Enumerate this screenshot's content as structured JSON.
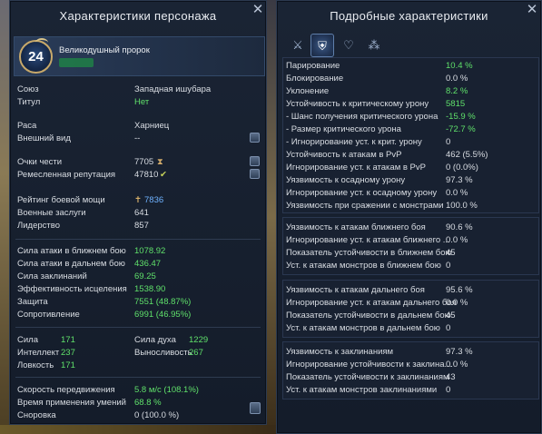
{
  "left": {
    "title": "Характеристики персонажа",
    "close": "✕",
    "character": {
      "level": "24",
      "title": "Великодушный пророк",
      "name_color": "#1f8a46"
    },
    "info": [
      {
        "label": "Союз",
        "value": "Западная ишубара"
      },
      {
        "label": "Титул",
        "value": "Нет"
      },
      {
        "label": "Раса",
        "value": "Харниец"
      },
      {
        "label": "Внешний вид",
        "value": "--"
      },
      {
        "label": "Очки чести",
        "value": "7705"
      },
      {
        "label": "Ремесленная репутация",
        "value": "47810"
      },
      {
        "label": "Рейтинг боевой мощи",
        "value": "7836"
      },
      {
        "label": "Военные заслуги",
        "value": "641"
      },
      {
        "label": "Лидерство",
        "value": "857"
      }
    ],
    "combat": [
      {
        "label": "Сила атаки в ближнем бою",
        "value": "1078.92"
      },
      {
        "label": "Сила атаки в дальнем бою",
        "value": "436.47"
      },
      {
        "label": "Сила заклинаний",
        "value": "69.25"
      },
      {
        "label": "Эффективность исцеления",
        "value": "1538.90"
      },
      {
        "label": "Защита",
        "value": "7551 (48.87%)"
      },
      {
        "label": "Сопротивление",
        "value": "6991 (46.95%)"
      }
    ],
    "attributes": [
      {
        "label": "Сила",
        "value": "171"
      },
      {
        "label": "Сила духа",
        "value": "1229"
      },
      {
        "label": "Интеллект",
        "value": "237"
      },
      {
        "label": "Выносливость",
        "value": "267"
      },
      {
        "label": "Ловкость",
        "value": "171"
      }
    ],
    "speed": [
      {
        "label": "Скорость передвижения",
        "value": "5.8 м/с (108.1%)"
      },
      {
        "label": "Время применения умений",
        "value": "68.8 %"
      },
      {
        "label": "Сноровка",
        "value": "0 (100.0 %)"
      }
    ]
  },
  "right": {
    "title": "Подробные характеристики",
    "close": "✕",
    "tabs": [
      "⚔",
      "⛨",
      "♡",
      "⁂"
    ],
    "section1": [
      {
        "label": "Парирование",
        "value": "10.4 %"
      },
      {
        "label": "Блокирование",
        "value": "0.0 %"
      },
      {
        "label": "Уклонение",
        "value": "8.2 %"
      },
      {
        "label": "Устойчивость к критическому урону",
        "value": "5815"
      },
      {
        "label": "- Шанс получения критического урона",
        "value": "-15.9 %"
      },
      {
        "label": "- Размер критического урона",
        "value": "-72.7 %"
      },
      {
        "label": "- Игнорирование уст. к крит. урону",
        "value": "0"
      },
      {
        "label": "Устойчивость к атакам в PvP",
        "value": "462 (5.5%)"
      },
      {
        "label": "Игнорирование уст. к атакам в PvP",
        "value": "0 (0.0%)"
      },
      {
        "label": "Уязвимость к осадному урону",
        "value": "97.3 %"
      },
      {
        "label": "Игнорирование уст. к осадному урону",
        "value": "0.0 %"
      },
      {
        "label": "Уязвимость при сражении с монстрами",
        "value": "100.0 %"
      }
    ],
    "section2": [
      {
        "label": "Уязвимость к атакам ближнего боя",
        "value": "90.6 %"
      },
      {
        "label": "Игнорирование уст. к атакам ближнего ...",
        "value": "0.0 %"
      },
      {
        "label": "Показатель устойчивости в ближнем бою",
        "value": "45"
      },
      {
        "label": "Уст. к атакам монстров в ближнем бою",
        "value": "0"
      }
    ],
    "section3": [
      {
        "label": "Уязвимость к атакам дальнего боя",
        "value": "95.6 %"
      },
      {
        "label": "Игнорирование уст. к атакам дальнего боя",
        "value": "0.0 %"
      },
      {
        "label": "Показатель устойчивости в дальнем бою",
        "value": "45"
      },
      {
        "label": "Уст. к атакам монстров в дальнем бою",
        "value": "0"
      }
    ],
    "section4": [
      {
        "label": "Уязвимость к заклинаниям",
        "value": "97.3 %"
      },
      {
        "label": "Игнорирование устойчивости к заклина...",
        "value": "0.0 %"
      },
      {
        "label": "Показатель устойчивости к заклинаниям",
        "value": "43"
      },
      {
        "label": "Уст. к атакам монстров заклинаниями",
        "value": "0"
      }
    ]
  },
  "colors": {
    "green": "#5fe06a",
    "blue": "#6fb2ff",
    "panel_bg": "#141c2a"
  }
}
